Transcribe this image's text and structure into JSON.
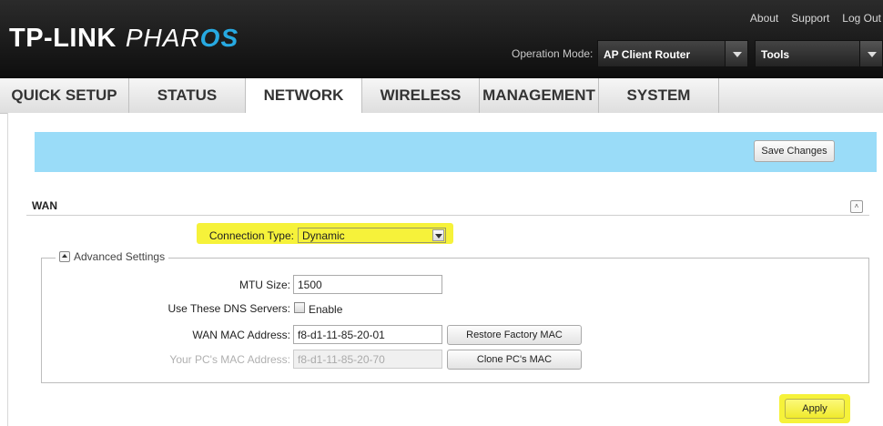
{
  "header": {
    "brand": "TP-LINK",
    "product_part1": "PHAR",
    "product_part2": "OS",
    "links": {
      "about": "About",
      "support": "Support",
      "logout": "Log Out"
    },
    "operation_mode_label": "Operation Mode:",
    "operation_mode_value": "AP Client Router",
    "tools_value": "Tools"
  },
  "nav": {
    "tabs": [
      {
        "label": "QUICK SETUP"
      },
      {
        "label": "STATUS"
      },
      {
        "label": "NETWORK",
        "active": true
      },
      {
        "label": "WIRELESS"
      },
      {
        "label": "MANAGEMENT"
      },
      {
        "label": "SYSTEM"
      }
    ]
  },
  "main": {
    "save_changes_label": "Save Changes",
    "section_title": "WAN",
    "connection_type_label": "Connection Type:",
    "connection_type_value": "Dynamic",
    "advanced_settings_label": "Advanced Settings",
    "mtu_label": "MTU Size:",
    "mtu_value": "1500",
    "dns_label": "Use These DNS Servers:",
    "dns_enable_label": "Enable",
    "wan_mac_label": "WAN MAC Address:",
    "wan_mac_value": "f8-d1-11-85-20-01",
    "restore_mac_label": "Restore Factory MAC",
    "pc_mac_label": "Your PC's MAC Address:",
    "pc_mac_value": "f8-d1-11-85-20-70",
    "clone_mac_label": "Clone PC's MAC",
    "apply_label": "Apply"
  },
  "colors": {
    "header_bg": "#1a1a1a",
    "accent_blue": "#27a9e1",
    "save_bar": "#9adcf8",
    "highlight": "#f6f23a"
  }
}
